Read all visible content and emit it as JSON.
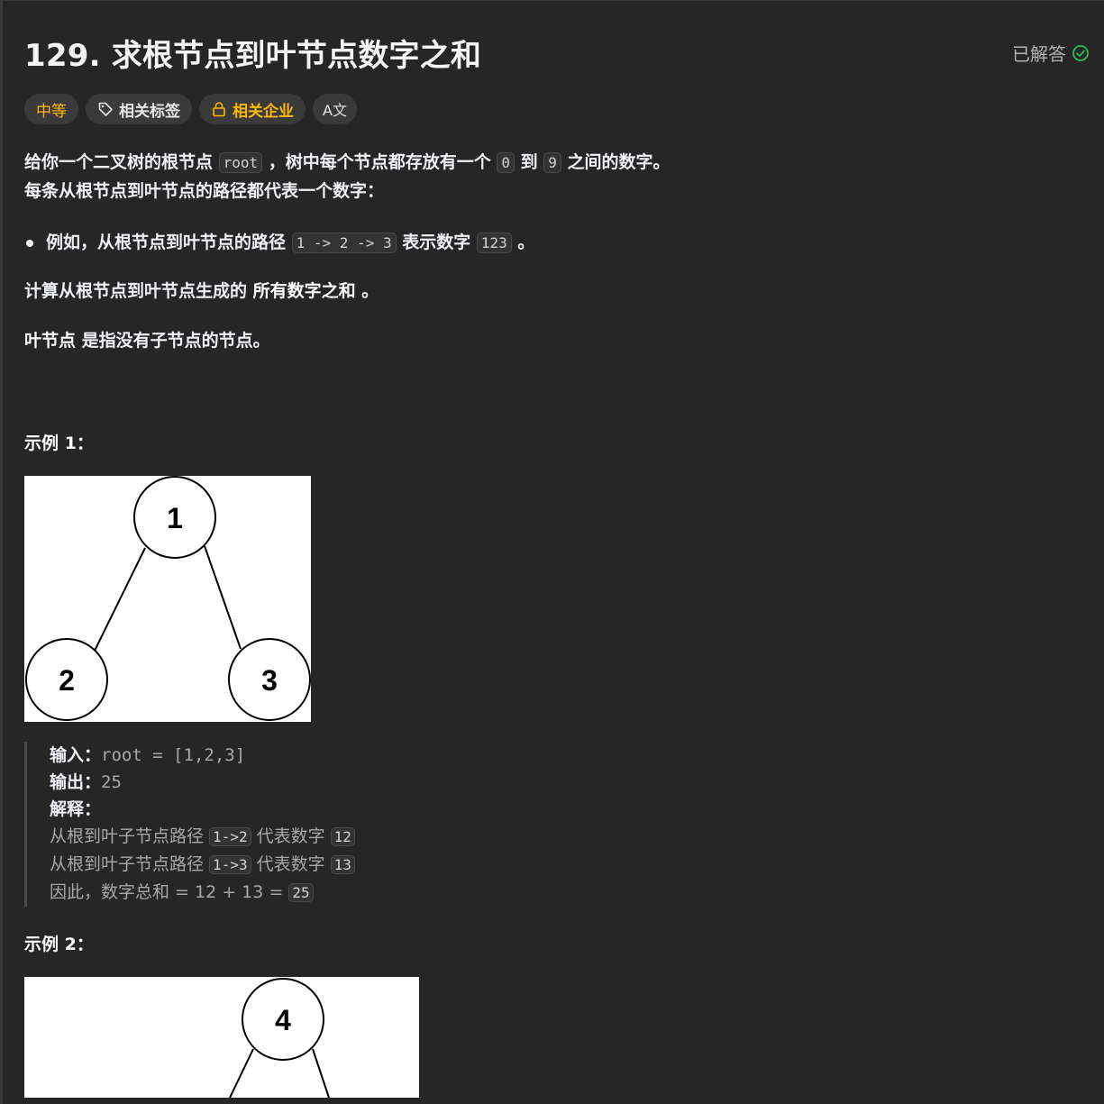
{
  "problem": {
    "title": "129. 求根节点到叶节点数字之和",
    "status": "已解答"
  },
  "tags": {
    "difficulty": "中等",
    "related_tags": "相关标签",
    "related_companies": "相关企业",
    "translate": "A文"
  },
  "description": {
    "line1_a": "给你一个二叉树的根节点 ",
    "line1_code1": "root",
    "line1_b": " ，树中每个节点都存放有一个 ",
    "line1_code2": "0",
    "line1_c": " 到 ",
    "line1_code3": "9",
    "line1_d": " 之间的数字。",
    "line2": "每条从根节点到叶节点的路径都代表一个数字：",
    "bullet_a": "例如，从根节点到叶节点的路径 ",
    "bullet_code1": "1 -> 2 -> 3",
    "bullet_b": " 表示数字 ",
    "bullet_code2": "123",
    "bullet_c": " 。",
    "line3_a": "计算从根节点到叶节点生成的 ",
    "line3_b": "所有数字之和",
    "line3_c": " 。",
    "line4_a": "叶节点",
    "line4_b": " 是指没有子节点的节点。"
  },
  "example1": {
    "heading": "示例 1：",
    "tree_nodes": [
      "1",
      "2",
      "3"
    ],
    "input_label": "输入：",
    "input_value": "root = [1,2,3]",
    "output_label": "输出：",
    "output_value": "25",
    "explain_label": "解释：",
    "exp1_a": "从根到叶子节点路径 ",
    "exp1_code1": "1->2",
    "exp1_b": " 代表数字 ",
    "exp1_code2": "12",
    "exp2_a": "从根到叶子节点路径 ",
    "exp2_code1": "1->3",
    "exp2_b": " 代表数字 ",
    "exp2_code2": "13",
    "exp3_a": "因此，数字总和 = 12 + 13 = ",
    "exp3_code": "25"
  },
  "example2": {
    "heading": "示例 2：",
    "tree_nodes": [
      "4"
    ]
  },
  "colors": {
    "background": "#262626",
    "difficulty": "#ffb800",
    "solved_check": "#2cbb5d"
  }
}
